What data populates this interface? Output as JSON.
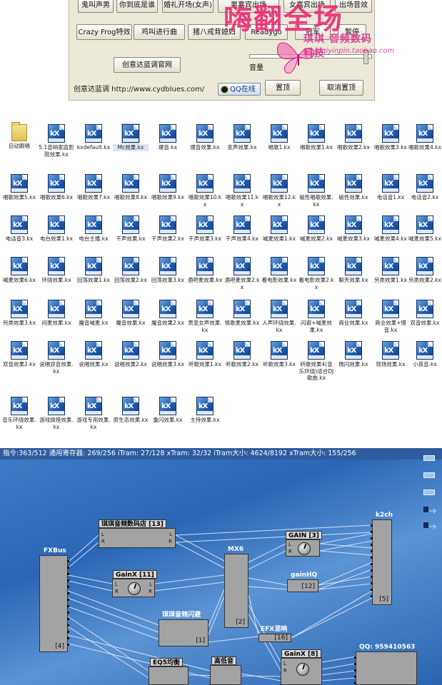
{
  "soundboard": {
    "row1": [
      "鬼叫声男",
      "你到底是谁",
      "婚礼开场(女声)",
      "男嘉宾出场",
      "女嘉宾出场",
      "出场音效"
    ],
    "row2": [
      "Crazy Frog特效",
      "鸡叫进行曲",
      "猪八戒背媳妇",
      "Readygo",
      "冠军",
      "暂停"
    ],
    "website_button": "创意达蓝调官网",
    "volume_label": "音量",
    "brand_text": "创意达蓝调 http://www.cydblues.com/",
    "qq_button": "QQ在线",
    "topmost_button": "置顶",
    "cancel_topmost_button": "取消置顶",
    "watermark_pink": "嗨翻全场",
    "watermark_shop": "琪琪 音频数码科技",
    "watermark_url": "qiqiyinpin.taobao.com",
    "colors": {
      "watermark": "#eb1e6e",
      "panel_bg": "#ece9d8"
    }
  },
  "files": [
    {
      "label": "自动跟唱",
      "type": "folder"
    },
    {
      "label": "5.1音响家庭影院效果.kx"
    },
    {
      "label": "kxdefault.kx"
    },
    {
      "label": "Mc效果.kx",
      "selected": true
    },
    {
      "label": "爆音.kx"
    },
    {
      "label": "爆音效果.kx"
    },
    {
      "label": "变声效果.kx"
    },
    {
      "label": "唱歌1.kx"
    },
    {
      "label": "唱歌效果1.kx"
    },
    {
      "label": "唱歌效果2.kx"
    },
    {
      "label": "唱歌效果3.kx"
    },
    {
      "label": "唱歌效果4.kx"
    },
    {
      "label": "唱歌效果5.kx"
    },
    {
      "label": "唱歌效果6.kx"
    },
    {
      "label": "唱歌效果7.kx"
    },
    {
      "label": "唱歌效果8.kx"
    },
    {
      "label": "唱歌效果9.kx"
    },
    {
      "label": "唱歌效果10.kx"
    },
    {
      "label": "唱歌效果11.kx"
    },
    {
      "label": "唱歌效果12.kx"
    },
    {
      "label": "磁性唱歌效果.kx"
    },
    {
      "label": "磁性效果.kx"
    },
    {
      "label": "电话音1.kx"
    },
    {
      "label": "电话音2.kx"
    },
    {
      "label": "电话音3.kx"
    },
    {
      "label": "电台效果1.kx"
    },
    {
      "label": "电台主播.kx"
    },
    {
      "label": "干声效果.kx"
    },
    {
      "label": "干声效果2.kx"
    },
    {
      "label": "干声效果3.kx"
    },
    {
      "label": "干声效果4.kx"
    },
    {
      "label": "喊麦效果1.kx"
    },
    {
      "label": "喊麦效果2.kx"
    },
    {
      "label": "喊麦效果3.kx"
    },
    {
      "label": "喊麦效果4.kx"
    },
    {
      "label": "喊麦效果5.kx"
    },
    {
      "label": "喊麦效果6.kx"
    },
    {
      "label": "环绕效果.kx"
    },
    {
      "label": "回荡效果1.kx"
    },
    {
      "label": "回荡效果2.kx"
    },
    {
      "label": "回荡效果3.kx"
    },
    {
      "label": "酒吧麦效果.kx"
    },
    {
      "label": "酒吧麦效果2.kx"
    },
    {
      "label": "看电影效果.kx"
    },
    {
      "label": "看电影效果2.kx"
    },
    {
      "label": "聊天效果.kx"
    },
    {
      "label": "另类效果1.kx"
    },
    {
      "label": "另类效果2.kx"
    },
    {
      "label": "另类效果3.kx"
    },
    {
      "label": "闷麦效果.kx"
    },
    {
      "label": "魔音喊麦.kx"
    },
    {
      "label": "魔音效果.kx"
    },
    {
      "label": "魔音效果2.kx"
    },
    {
      "label": "男变女声效果.kx"
    },
    {
      "label": "情歌麦效果.kx"
    },
    {
      "label": "人声环绕效果.kx"
    },
    {
      "label": "闪避+喊麦效果.kx"
    },
    {
      "label": "商业效果.kx"
    },
    {
      "label": "商业效果+爆音.kx"
    },
    {
      "label": "双音效果.kx"
    },
    {
      "label": "双音效果2.kx"
    },
    {
      "label": "说唱双音效果.kx"
    },
    {
      "label": "说唱效果.kx"
    },
    {
      "label": "说唱效果2.kx"
    },
    {
      "label": "说唱效果3.kx"
    },
    {
      "label": "听歌效果1.kx"
    },
    {
      "label": "听歌效果2.kx"
    },
    {
      "label": "听歌效果3.kx"
    },
    {
      "label": "听歌效果4(音乐环绕)适合DJ歌曲.kx"
    },
    {
      "label": "微闪效果.kx"
    },
    {
      "label": "现场效果.kx"
    },
    {
      "label": "小孩音.kx"
    },
    {
      "label": "音乐环绕效果.kx"
    },
    {
      "label": "游戏搞怪效果.kx"
    },
    {
      "label": "游戏专用效果.kx"
    },
    {
      "label": "原生态效果.kx"
    },
    {
      "label": "重闪效果.kx"
    },
    {
      "label": "主持效果.kx"
    }
  ],
  "dsp": {
    "status_bar": "指令:363/512 通用寄存器: 269/256 iTram: 27/128 xTram: 32/32 iTram大小: 4624/8192 xTram大小: 155/256",
    "blocks": {
      "fxbus": {
        "title": "FXBus",
        "num": "[4]"
      },
      "shop": {
        "title": "琪琪音频数码店 [13]"
      },
      "gainx": {
        "title": "GainX [11]"
      },
      "qqshan": {
        "title": "琪琪音频闪避",
        "num": "[1]"
      },
      "mx6": {
        "title": "MX6",
        "num": "[2]"
      },
      "gain3": {
        "title": "GAIN [3]"
      },
      "gainhq": {
        "title": "gainHQ",
        "num": "[12]"
      },
      "k2": {
        "title": "k2ch",
        "num": "[5]"
      },
      "efx": {
        "title": "EFX混响",
        "num": "[16]"
      },
      "gain8": {
        "title": "GainX [8]"
      },
      "eq5": {
        "title": "EQ5均衡"
      },
      "gaoyin": {
        "title": "高低音"
      },
      "qq": {
        "title": "QQ: 959410563"
      }
    },
    "lr": {
      "l": "L",
      "r": "R"
    }
  }
}
